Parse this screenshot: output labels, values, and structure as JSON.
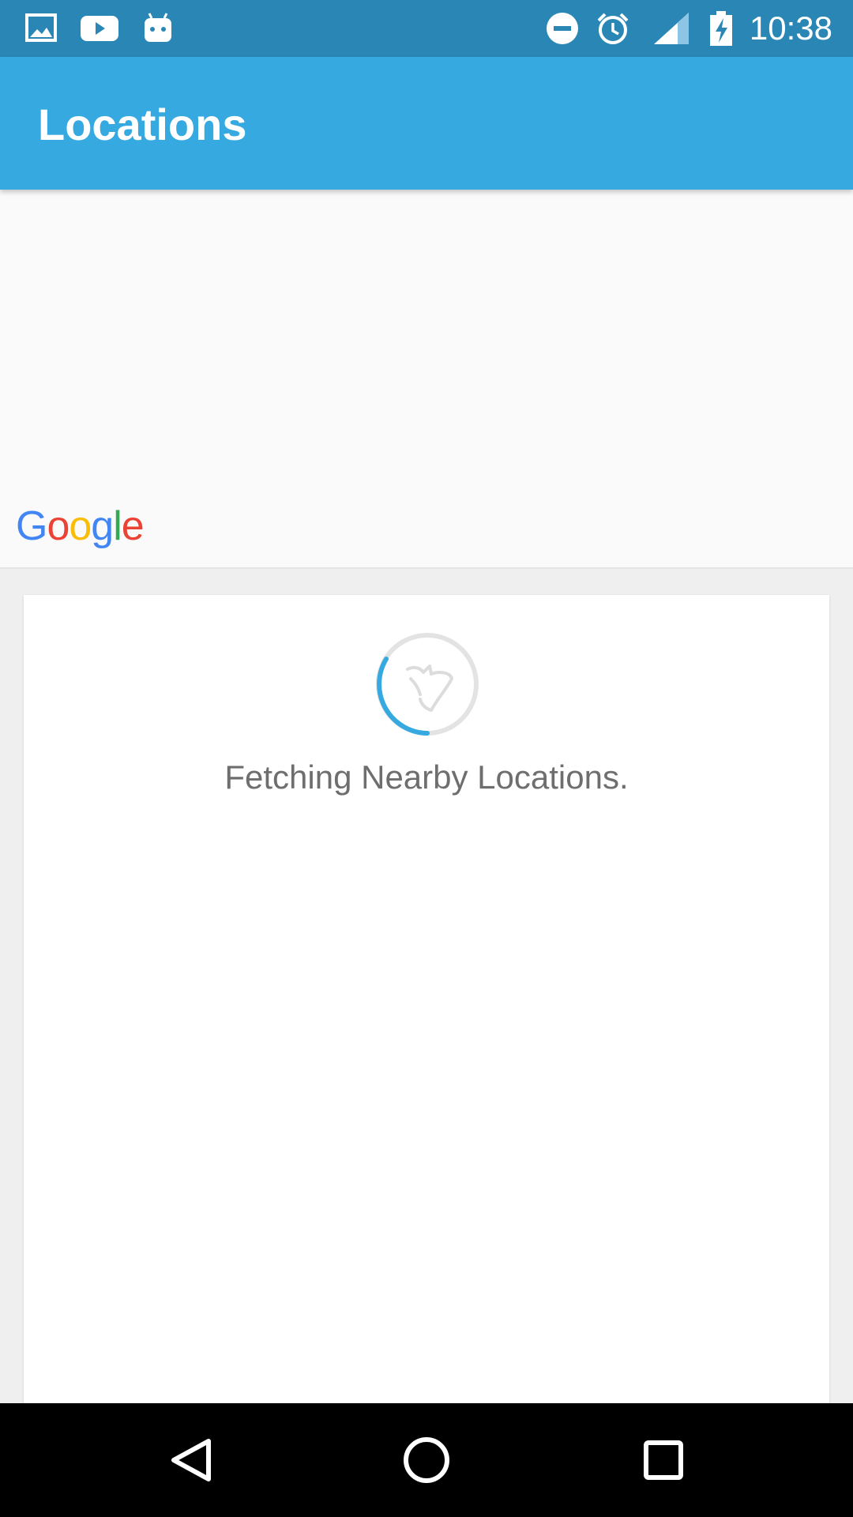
{
  "status_bar": {
    "time": "10:38",
    "left_icons": [
      "gallery-icon",
      "youtube-icon",
      "android-icon"
    ],
    "right_icons": [
      "do-not-disturb-icon",
      "alarm-icon",
      "signal-icon",
      "battery-charging-icon"
    ],
    "background": "#2a87b5"
  },
  "app_bar": {
    "title": "Locations",
    "background": "#36a9e0"
  },
  "map": {
    "logo_text": "Google",
    "logo_colors": [
      "#4285f4",
      "#ea4335",
      "#fbbc05",
      "#4285f4",
      "#34a853",
      "#ea4335"
    ]
  },
  "card": {
    "loading_text": "Fetching Nearby Locations.",
    "spinner_accent": "#36a9e0"
  },
  "nav_bar": {
    "buttons": [
      "back-icon",
      "home-icon",
      "recents-icon"
    ]
  }
}
